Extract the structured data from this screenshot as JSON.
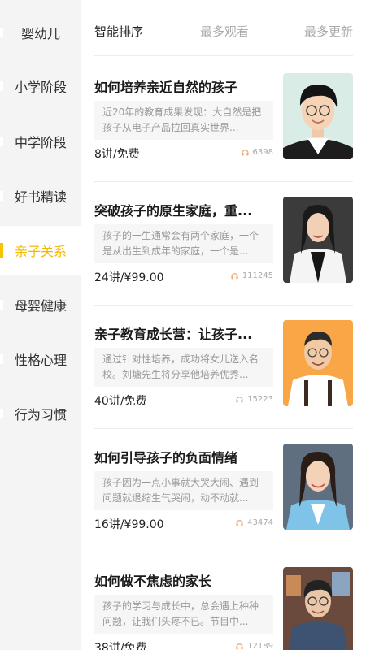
{
  "sidebar": {
    "items": [
      {
        "label": "婴幼儿"
      },
      {
        "label": "小学阶段"
      },
      {
        "label": "中学阶段"
      },
      {
        "label": "好书精读"
      },
      {
        "label": "亲子关系"
      },
      {
        "label": "母婴健康"
      },
      {
        "label": "性格心理"
      },
      {
        "label": "行为习惯"
      }
    ],
    "active_index": 4,
    "accent_color": "#f8c300"
  },
  "sort_tabs": [
    {
      "label": "智能排序"
    },
    {
      "label": "最多观看"
    },
    {
      "label": "最多更新"
    }
  ],
  "courses": [
    {
      "title": "如何培养亲近自然的孩子",
      "description": "近20年的教育成果发现：大自然是把孩子从电子产品拉回真实世界...",
      "price": "8讲/免费",
      "plays": "6398",
      "thumb_icon": "teacher-portrait-icon"
    },
    {
      "title": "突破孩子的原生家庭，重...",
      "description": "孩子的一生通常会有两个家庭，一个是从出生到成年的家庭，一个是...",
      "price": "24讲/¥99.00",
      "plays": "111245",
      "thumb_icon": "teacher-portrait-icon"
    },
    {
      "title": "亲子教育成长营：让孩子...",
      "description": "通过针对性培养，成功将女儿送入名校。刘墉先生将分享他培养优秀...",
      "price": "40讲/免费",
      "plays": "15223",
      "thumb_icon": "teacher-portrait-icon"
    },
    {
      "title": "如何引导孩子的负面情绪",
      "description": "孩子因为一点小事就大哭大闹、遇到问题就退缩生气哭闹，动不动就...",
      "price": "16讲/¥99.00",
      "plays": "43474",
      "thumb_icon": "teacher-portrait-icon"
    },
    {
      "title": "如何做不焦虑的家长",
      "description": "孩子的学习与成长中，总会遇上种种问题，让我们头疼不已。节目中...",
      "price": "38讲/免费",
      "plays": "12189",
      "thumb_icon": "teacher-portrait-icon"
    }
  ]
}
